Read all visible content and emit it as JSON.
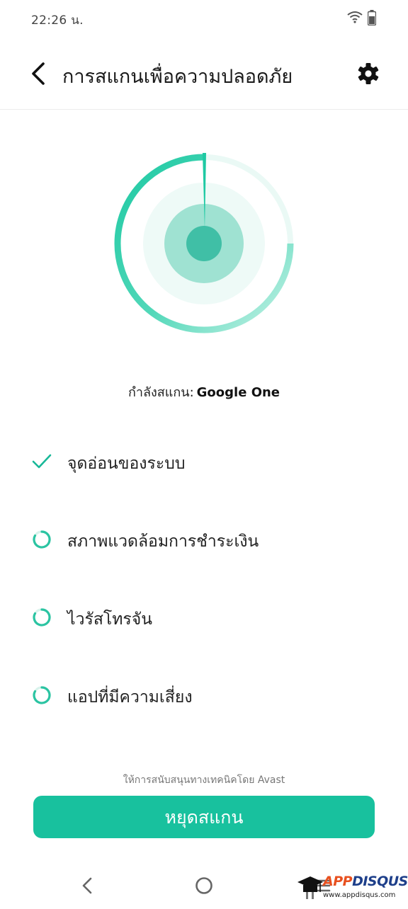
{
  "status_bar": {
    "time": "22:26 น.",
    "wifi_icon": "wifi-icon",
    "battery_icon": "battery-icon"
  },
  "header": {
    "title": "การสแกนเพื่อความปลอดภัย",
    "back_icon": "back-arrow-icon",
    "settings_icon": "gear-icon"
  },
  "scan": {
    "status_prefix": "กำลังสแกน:",
    "current_app": "Google One",
    "accent_color": "#18c19e"
  },
  "checks": [
    {
      "label": "จุดอ่อนของระบบ",
      "state": "done",
      "icon": "checkmark-icon"
    },
    {
      "label": "สภาพแวดล้อมการชำระเงิน",
      "state": "scanning",
      "icon": "loading-spinner-icon"
    },
    {
      "label": "ไวรัสโทรจัน",
      "state": "scanning",
      "icon": "loading-spinner-icon"
    },
    {
      "label": "แอปที่มีความเสี่ยง",
      "state": "scanning",
      "icon": "loading-spinner-icon"
    }
  ],
  "footer": {
    "powered_by": "ให้การสนับสนุนทางเทคนิคโดย Avast",
    "stop_button": "หยุดสแกน"
  },
  "nav": {
    "back_icon": "nav-back-icon",
    "home_icon": "nav-home-icon",
    "menu_icon": "nav-menu-icon"
  },
  "watermark": {
    "logo_app": "APP",
    "logo_disqus": "DISQUS",
    "url": "www.appdisqus.com"
  }
}
